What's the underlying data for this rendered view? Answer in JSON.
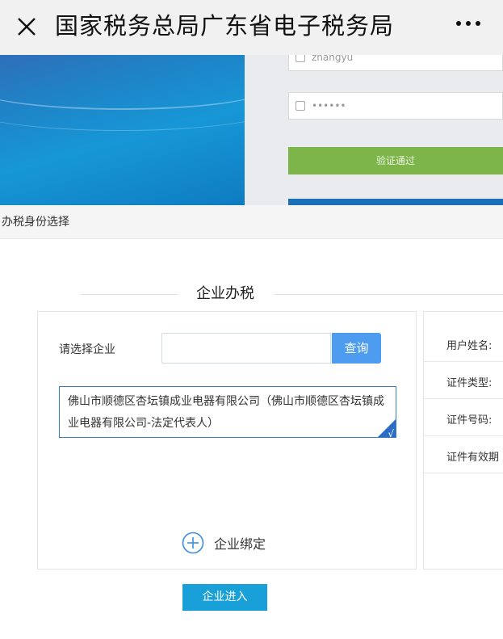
{
  "app": {
    "title": "国家税务总局广东省电子税务局"
  },
  "background_login": {
    "username_value": "zhangyu",
    "password_value": "••••••",
    "verify_button_label": "验证通过"
  },
  "dialog": {
    "title": "办税身份选择",
    "section_title": "企业办税",
    "select_label": "请选择企业",
    "search_placeholder": "",
    "search_button_label": "查询",
    "company_item_text": "佛山市顺德区杏坛镇成业电器有限公司（佛山市顺德区杏坛镇成业电器有限公司-法定代表人）",
    "check_mark": "√",
    "bind_label": "企业绑定",
    "enter_button_label": "企业进入"
  },
  "user_info": {
    "fields": [
      {
        "label": "用户姓名:"
      },
      {
        "label": "证件类型:"
      },
      {
        "label": "证件号码:"
      },
      {
        "label": "证件有效期"
      }
    ]
  },
  "colors": {
    "accent_blue": "#4e9cf0",
    "enter_button": "#1aa0d8",
    "verify_green": "#7db54a",
    "selected_border": "#3a7bc8"
  },
  "icons": {
    "close": "close-icon",
    "more": "more-icon",
    "add": "plus-circle-icon",
    "lock": "lock-icon",
    "user": "user-icon"
  }
}
